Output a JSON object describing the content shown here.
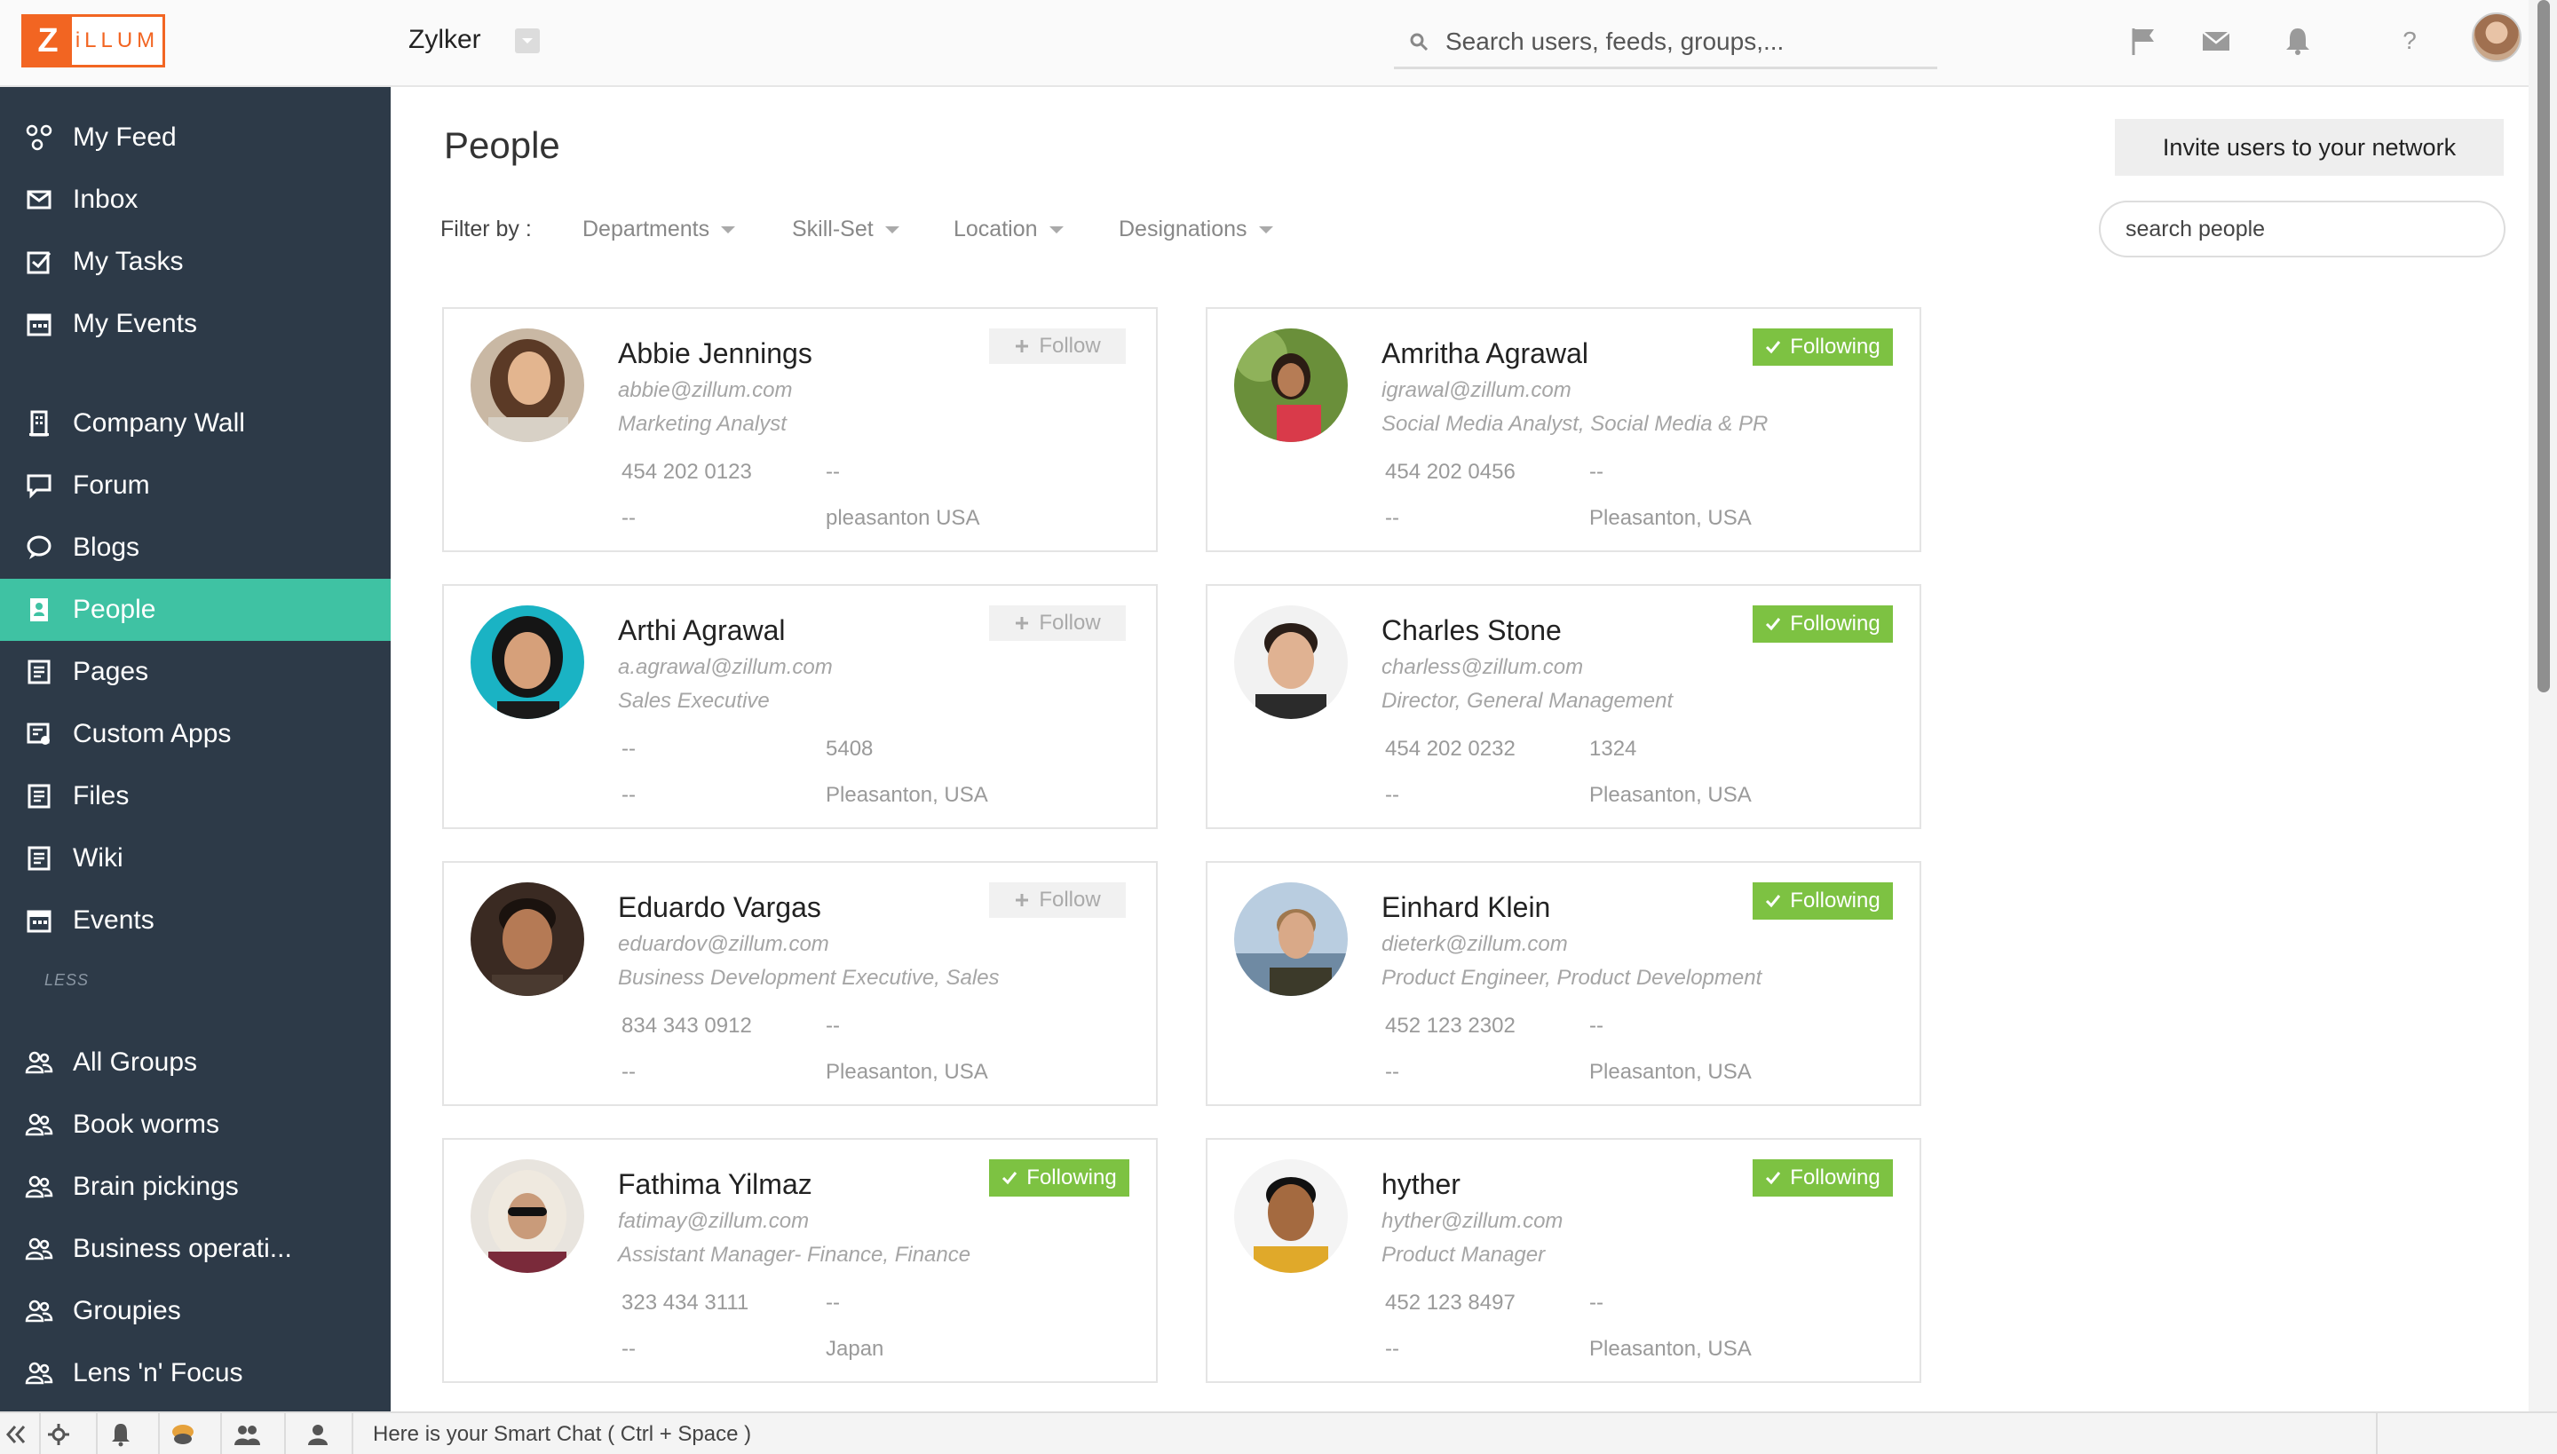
{
  "topbar": {
    "logo_letter": "Z",
    "logo_text": "iLLUM",
    "org_name": "Zylker",
    "search_placeholder": "Search users, feeds, groups,...",
    "help_label": "?"
  },
  "sidebar": {
    "items": [
      {
        "label": "My Feed",
        "icon": "feed-icon"
      },
      {
        "label": "Inbox",
        "icon": "inbox-icon"
      },
      {
        "label": "My Tasks",
        "icon": "tasks-icon"
      },
      {
        "label": "My Events",
        "icon": "calendar-icon"
      },
      {
        "label": "Company Wall",
        "icon": "building-icon"
      },
      {
        "label": "Forum",
        "icon": "forum-icon"
      },
      {
        "label": "Blogs",
        "icon": "blog-icon"
      },
      {
        "label": "People",
        "icon": "person-card-icon"
      },
      {
        "label": "Pages",
        "icon": "pages-icon"
      },
      {
        "label": "Custom Apps",
        "icon": "apps-icon"
      },
      {
        "label": "Files",
        "icon": "files-icon"
      },
      {
        "label": "Wiki",
        "icon": "wiki-icon"
      },
      {
        "label": "Events",
        "icon": "calendar-icon"
      },
      {
        "label": "All Groups",
        "icon": "group-icon"
      },
      {
        "label": "Book worms",
        "icon": "group-icon"
      },
      {
        "label": "Brain pickings",
        "icon": "group-icon"
      },
      {
        "label": "Business operati...",
        "icon": "group-icon"
      },
      {
        "label": "Groupies",
        "icon": "group-icon"
      },
      {
        "label": "Lens 'n' Focus",
        "icon": "group-icon"
      }
    ],
    "less_label": "LESS",
    "active": "People"
  },
  "main": {
    "title": "People",
    "invite_label": "Invite users to your network",
    "filter_label": "Filter by :",
    "filters": [
      "Departments",
      "Skill-Set",
      "Location",
      "Designations"
    ],
    "search_placeholder": "search people"
  },
  "people": [
    {
      "name": "Abbie Jennings",
      "email": "abbie@zillum.com",
      "role": "Marketing Analyst",
      "phone": "454 202 0123",
      "ext": "--",
      "mobile": "--",
      "location": "pleasanton USA",
      "status": "Follow",
      "following": false
    },
    {
      "name": "Amritha Agrawal",
      "email": "igrawal@zillum.com",
      "role": "Social Media Analyst, Social Media & PR",
      "phone": "454 202 0456",
      "ext": "--",
      "mobile": "--",
      "location": "Pleasanton, USA",
      "status": "Following",
      "following": true
    },
    {
      "name": "Arthi Agrawal",
      "email": "a.agrawal@zillum.com",
      "role": "Sales Executive",
      "phone": "--",
      "ext": "5408",
      "mobile": "--",
      "location": "Pleasanton, USA",
      "status": "Follow",
      "following": false
    },
    {
      "name": "Charles Stone",
      "email": "charless@zillum.com",
      "role": "Director, General Management",
      "phone": "454 202 0232",
      "ext": "1324",
      "mobile": "--",
      "location": "Pleasanton, USA",
      "status": "Following",
      "following": true
    },
    {
      "name": "Eduardo Vargas",
      "email": "eduardov@zillum.com",
      "role": "Business Development Executive, Sales",
      "phone": "834 343 0912",
      "ext": "--",
      "mobile": "--",
      "location": "Pleasanton, USA",
      "status": "Follow",
      "following": false
    },
    {
      "name": "Einhard Klein",
      "email": "dieterk@zillum.com",
      "role": "Product Engineer, Product Development",
      "phone": "452 123 2302",
      "ext": "--",
      "mobile": "--",
      "location": "Pleasanton, USA",
      "status": "Following",
      "following": true
    },
    {
      "name": "Fathima Yilmaz",
      "email": "fatimay@zillum.com",
      "role": "Assistant Manager- Finance, Finance",
      "phone": "323 434 3111",
      "ext": "--",
      "mobile": "--",
      "location": "Japan",
      "status": "Following",
      "following": true
    },
    {
      "name": "hyther",
      "email": "hyther@zillum.com",
      "role": "Product Manager",
      "phone": "452 123 8497",
      "ext": "--",
      "mobile": "--",
      "location": "Pleasanton, USA",
      "status": "Following",
      "following": true
    }
  ],
  "bottombar": {
    "smartchat_text": "Here is your Smart Chat ( Ctrl + Space )"
  },
  "colors": {
    "sidebar_bg": "#2d3a48",
    "active_bg": "#3fc2a3",
    "following_green": "#7dc242",
    "brand_orange": "#f26522"
  }
}
